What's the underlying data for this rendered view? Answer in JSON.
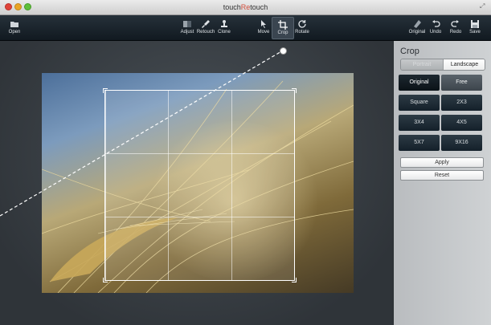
{
  "window": {
    "title_prefix": "touch",
    "title_accent": "Re",
    "title_suffix": "touch"
  },
  "toolbar": {
    "open": "Open",
    "adjust": "Adjust",
    "retouch": "Retouch",
    "clone": "Clone",
    "move": "Move",
    "crop": "Crop",
    "rotate": "Rotate",
    "original": "Original",
    "undo": "Undo",
    "redo": "Redo",
    "save": "Save"
  },
  "panel": {
    "title": "Crop",
    "orientation": {
      "portrait": "Portrait",
      "landscape": "Landscape",
      "selected": "Landscape"
    },
    "ratios": [
      "Original",
      "Free",
      "Square",
      "2X3",
      "3X4",
      "4X5",
      "5X7",
      "9X16"
    ],
    "selected_ratio": "Original",
    "apply": "Apply",
    "reset": "Reset"
  }
}
